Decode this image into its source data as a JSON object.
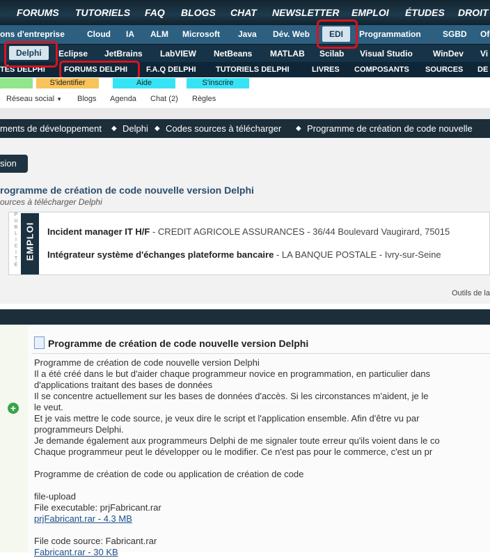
{
  "nav_top": [
    "FORUMS",
    "TUTORIELS",
    "FAQ",
    "BLOGS",
    "CHAT",
    "NEWSLETTER",
    "EMPLOI",
    "ÉTUDES",
    "DROIT"
  ],
  "nav_categories": [
    "ons d'entreprise",
    "Cloud",
    "IA",
    "ALM",
    "Microsoft",
    "Java",
    "Dév. Web",
    "EDI",
    "Programmation",
    "SGBD",
    "Of"
  ],
  "nav_edi": [
    "Delphi",
    "Eclipse",
    "JetBrains",
    "LabVIEW",
    "NetBeans",
    "MATLAB",
    "Scilab",
    "Visual Studio",
    "WinDev",
    "Vi"
  ],
  "nav_delphi": [
    "TÉS DELPHI",
    "FORUMS DELPHI",
    "F.A.Q DELPHI",
    "TUTORIELS DELPHI",
    "LIVRES",
    "COMPOSANTS",
    "SOURCES",
    "DE"
  ],
  "account": {
    "login": "S'identifier",
    "help": "Aide",
    "register": "S'inscrire"
  },
  "subnav": [
    "Réseau social",
    "Blogs",
    "Agenda",
    "Chat (2)",
    "Règles"
  ],
  "breadcrumb": [
    "ments de développement",
    "Delphi",
    "Codes sources à télécharger",
    "Programme de création de code nouvelle"
  ],
  "version_button": "sion",
  "thread": {
    "title": "rogramme de création de code nouvelle version Delphi",
    "subtitle": "ources à télécharger Delphi"
  },
  "ad": {
    "pub_label": "PUBLICITÉ",
    "emploi_label": "EMPLOI",
    "jobs": [
      {
        "title": "Incident manager IT H/F",
        "detail": " - CREDIT AGRICOLE ASSURANCES - 36/44 Boulevard Vaugirard, 75015"
      },
      {
        "title": "Intégrateur système d'échanges plateforme bancaire",
        "detail": " - LA BANQUE POSTALE - Ivry-sur-Seine"
      }
    ]
  },
  "tools_label": "Outils de la",
  "post": {
    "title": "Programme de création de code nouvelle version Delphi",
    "lines": [
      "Programme de création de code nouvelle version Delphi",
      "Il a été créé dans le but d'aider chaque programmeur novice en programmation, en particulier dans",
      "d'applications traitant des bases de données",
      "Il se concentre actuellement sur les bases de données d'accès. Si les circonstances m'aident, je le",
      "le veut.",
      "Et je vais mettre le code source, je veux dire le script et l'application ensemble. Afin d'être vu par",
      "programmeurs Delphi.",
      "Je demande également aux programmeurs Delphi de me signaler toute erreur qu'ils voient dans le co",
      "Chaque programmeur peut le développer ou le modifier. Ce n'est pas pour le commerce, c'est un pr",
      "",
      "Programme de création de code ou application de création de code",
      "",
      "file-upload",
      "File executable: prjFabricant.rar"
    ],
    "link1": "prjFabricant.rar - 4.3 MB",
    "file2_label": "File code source: Fabricant.rar",
    "link2": "Fabricant.rar - 30 KB"
  },
  "colors": {
    "highlight": "#d7141e",
    "login": "#f7c35a",
    "help": "#36e3f4",
    "register": "#36e3f4",
    "green": "#8fe68b"
  }
}
